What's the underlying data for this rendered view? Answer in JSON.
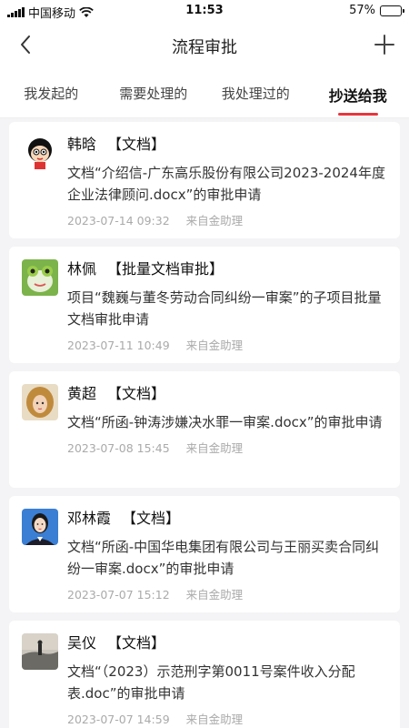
{
  "status": {
    "carrier": "中国移动",
    "time": "11:53",
    "battery": "57%",
    "battery_level": 0.57
  },
  "nav": {
    "title": "流程审批",
    "back_icon": "chevron-left-icon",
    "add_icon": "plus-icon"
  },
  "tabs": [
    {
      "label": "我发起的",
      "active": false
    },
    {
      "label": "需要处理的",
      "active": false
    },
    {
      "label": "我处理过的",
      "active": false
    },
    {
      "label": "抄送给我",
      "active": true
    }
  ],
  "items": [
    {
      "name": "韩晗",
      "tag": "【文档】",
      "desc": "文档“介绍信-广东高乐股份有限公司2023-2024年度企业法律顾问.docx”的审批申请",
      "time": "2023-07-14 09:32",
      "source": "来自金助理",
      "avatar": "cartoon"
    },
    {
      "name": "林佩",
      "tag": "【批量文档审批】",
      "desc": "项目“魏巍与董冬劳动合同纠纷一审案”的子项目批量文档审批申请",
      "time": "2023-07-11 10:49",
      "source": "来自金助理",
      "avatar": "frog"
    },
    {
      "name": "黄超",
      "tag": "【文档】",
      "desc": "文档“所函-钟涛涉嫌决水罪一审案.docx”的审批申请",
      "time": "2023-07-08 15:45",
      "source": "来自金助理",
      "avatar": "girl"
    },
    {
      "name": "邓林霞",
      "tag": "【文档】",
      "desc": "文档“所函-中国华电集团有限公司与王丽买卖合同纠纷一审案.docx”的审批申请",
      "time": "2023-07-07 15:12",
      "source": "来自金助理",
      "avatar": "portrait"
    },
    {
      "name": "吴仪",
      "tag": "【文档】",
      "desc": "文档“（2023）示范刑字第0011号案件收入分配表.doc”的审批申请",
      "time": "2023-07-07 14:59",
      "source": "来自金助理",
      "avatar": "landscape"
    }
  ]
}
